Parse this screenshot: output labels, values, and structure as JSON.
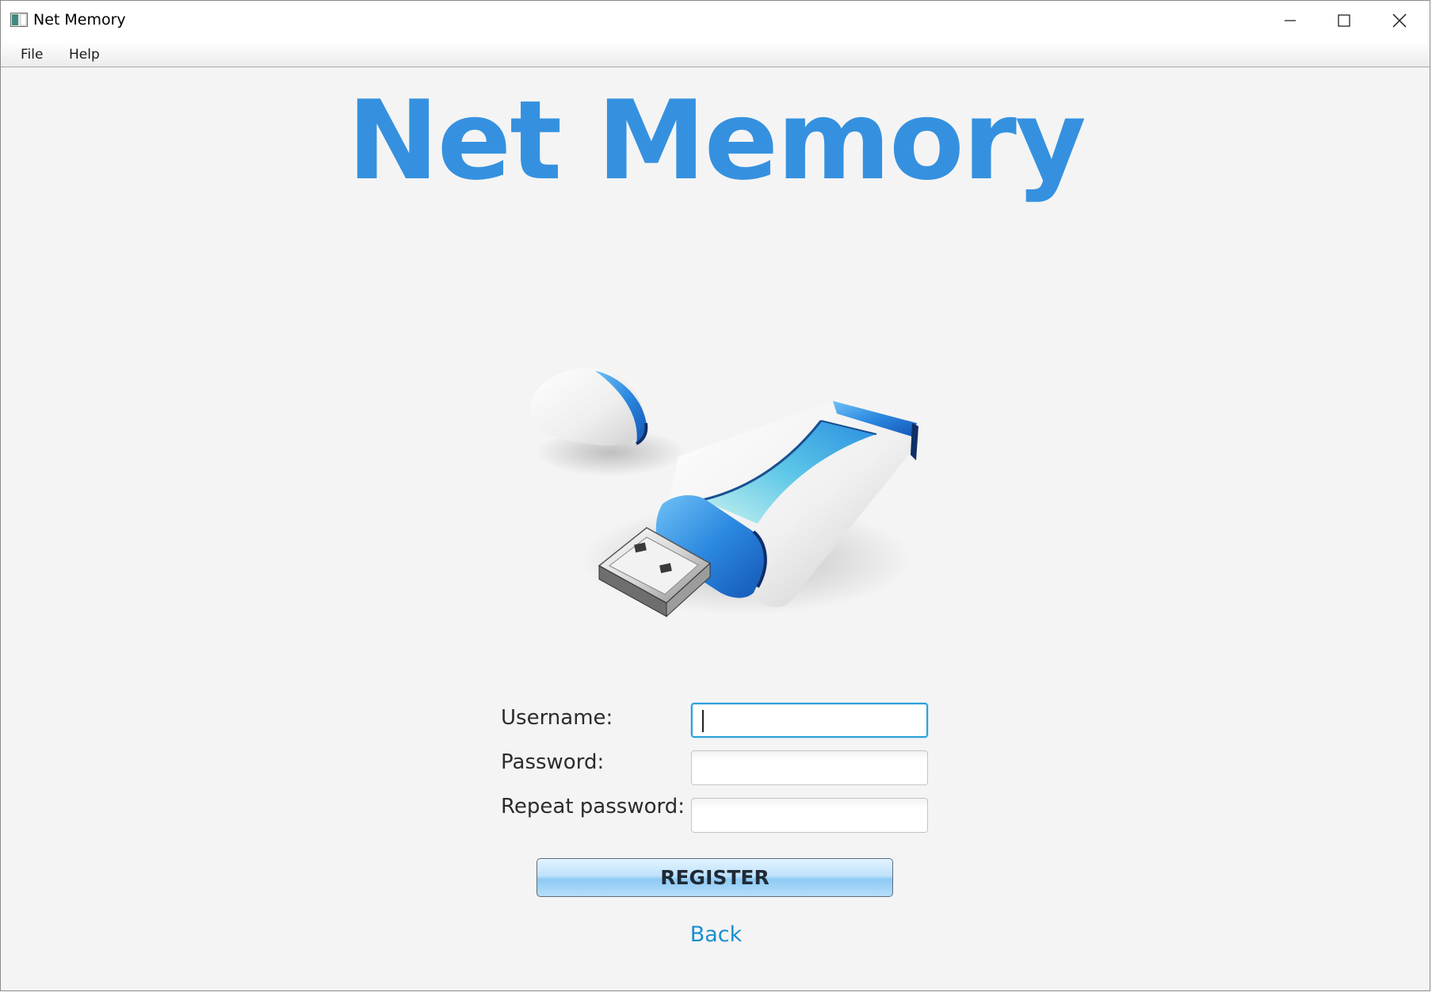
{
  "window": {
    "title": "Net Memory",
    "controls": [
      "minimize",
      "maximize",
      "close"
    ]
  },
  "menu": {
    "items": [
      {
        "label": "File"
      },
      {
        "label": "Help"
      }
    ]
  },
  "main": {
    "app_title": "Net Memory",
    "image": "usb-flash-drive-icon",
    "form": {
      "username_label": "Username:",
      "username_value": "",
      "password_label": "Password:",
      "password_value": "",
      "repeat_password_label": "Repeat password:",
      "repeat_password_value": ""
    },
    "register_label": "REGISTER",
    "back_label": "Back"
  },
  "colors": {
    "title": "#3591df",
    "link": "#1a8fcf",
    "focus": "#2f9fd8",
    "background": "#f4f4f4"
  }
}
